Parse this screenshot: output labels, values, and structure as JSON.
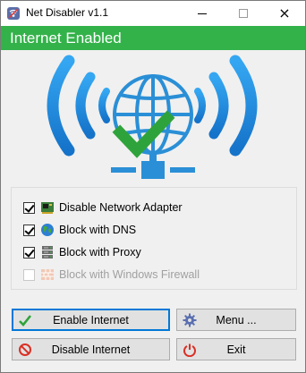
{
  "window": {
    "title": "Net Disabler v1.1",
    "controls": {
      "minimize": "minimize",
      "maximize": "maximize",
      "close": "×"
    }
  },
  "status": {
    "text": "Internet Enabled",
    "color": "#33b24a"
  },
  "hero": {
    "icon": "globe-wifi-check-icon",
    "colors": {
      "waves": "#1e8fe0",
      "globe": "#2a8fd6",
      "check": "#2fa33b"
    }
  },
  "options": [
    {
      "label": "Disable Network Adapter",
      "checked": true,
      "enabled": true,
      "icon": "network-adapter-icon"
    },
    {
      "label": "Block with DNS",
      "checked": true,
      "enabled": true,
      "icon": "globe-icon"
    },
    {
      "label": "Block with Proxy",
      "checked": true,
      "enabled": true,
      "icon": "server-icon"
    },
    {
      "label": "Block with Windows Firewall",
      "checked": false,
      "enabled": false,
      "icon": "firewall-icon"
    }
  ],
  "buttons": {
    "enable": {
      "label": "Enable Internet",
      "icon": "check-icon"
    },
    "menu": {
      "label": "Menu ...",
      "icon": "gear-icon"
    },
    "disable": {
      "label": "Disable Internet",
      "icon": "prohibited-icon"
    },
    "exit": {
      "label": "Exit",
      "icon": "power-icon"
    }
  }
}
